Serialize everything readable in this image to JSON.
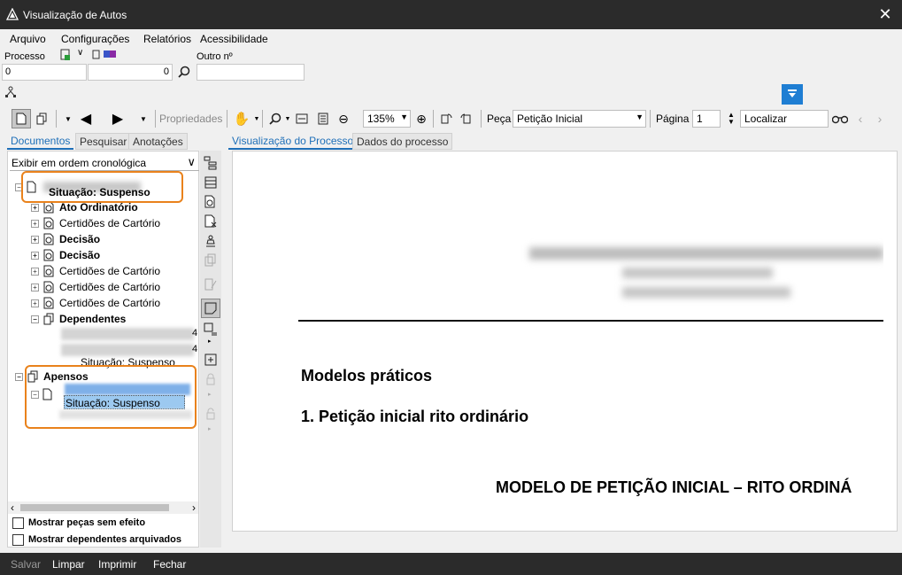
{
  "window": {
    "title": "Visualização de Autos",
    "close_icon": "close-icon"
  },
  "menu": {
    "items": [
      "Arquivo",
      "Configurações",
      "Relatórios",
      "Acessibilidade"
    ]
  },
  "process": {
    "label": "Processo",
    "number_prefix": "0",
    "number_suffix": "0",
    "other_label": "Outro nº",
    "other_value": ""
  },
  "toolbar": {
    "properties_label": "Propriedades",
    "zoom_value": "135%",
    "piece_label": "Peça",
    "piece_value": "Petição Inicial",
    "page_label": "Página",
    "page_value": "1",
    "search_value": "Localizar"
  },
  "left_tabs": [
    "Documentos",
    "Pesquisar",
    "Anotações"
  ],
  "doc_tabs": [
    "Visualização do Processo",
    "Dados do processo"
  ],
  "order_select": "Exibir em ordem cronológica",
  "tree": {
    "root_status": "Situação: Suspenso",
    "items": [
      {
        "label": "Ato Ordinatório",
        "bold": true
      },
      {
        "label": "Certidões de Cartório",
        "bold": false
      },
      {
        "label": "Decisão",
        "bold": true
      },
      {
        "label": "Decisão",
        "bold": true
      },
      {
        "label": "Certidões de Cartório",
        "bold": false
      },
      {
        "label": "Certidões de Cartório",
        "bold": false
      },
      {
        "label": "Certidões de Cartório",
        "bold": false
      }
    ],
    "dependents_label": "Dependentes",
    "dependents_status": "Situação: Suspenso",
    "dependents_num1": "4",
    "dependents_num2": "4",
    "apensos_label": "Apensos",
    "apensos_status": "Situação: Suspenso"
  },
  "checkboxes": {
    "show_no_effect": "Mostrar peças sem efeito",
    "show_archived": "Mostrar dependentes arquivados"
  },
  "document": {
    "heading1": "Modelos práticos",
    "heading2": "1. Petição inicial rito ordinário",
    "heading3": "MODELO DE PETIÇÃO INICIAL – RITO ORDINÁ"
  },
  "bottom": {
    "buttons": [
      "Salvar",
      "Limpar",
      "Imprimir",
      "Fechar"
    ]
  }
}
